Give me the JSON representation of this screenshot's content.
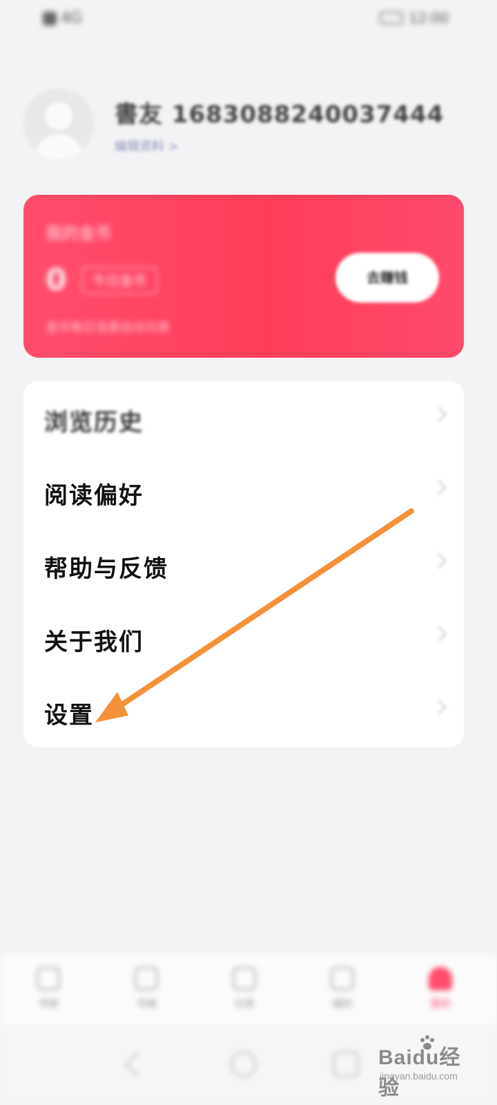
{
  "status_bar": {
    "left_text": "4G",
    "right_text": "12:00"
  },
  "profile": {
    "username": "書友 1683088240037444",
    "sublink": "编辑资料 >"
  },
  "coin_card": {
    "title": "我的金币",
    "value": "0",
    "unit_label": "今日金币",
    "note": "金币每日凌晨自动兑换",
    "button_label": "去赚钱"
  },
  "menu": {
    "items": [
      {
        "label": "浏览历史",
        "blurred": true
      },
      {
        "label": "阅读偏好",
        "blurred": false
      },
      {
        "label": "帮助与反馈",
        "blurred": false
      },
      {
        "label": "关于我们",
        "blurred": false
      },
      {
        "label": "设置",
        "blurred": false
      }
    ]
  },
  "annotation": {
    "arrow_color": "#f5913a"
  },
  "bottom_nav": {
    "tabs": [
      {
        "label": "书架",
        "icon": "home-icon",
        "active": false
      },
      {
        "label": "书城",
        "icon": "book-icon",
        "active": false
      },
      {
        "label": "分类",
        "icon": "category-icon",
        "active": false
      },
      {
        "label": "福利",
        "icon": "gift-icon",
        "active": false
      },
      {
        "label": "我的",
        "icon": "user-icon",
        "active": true
      }
    ]
  },
  "watermark": {
    "logo": "Baidu经验",
    "url": "jingyan.baidu.com"
  },
  "colors": {
    "accent": "#ff4d6d",
    "background": "#f3f3f5"
  }
}
